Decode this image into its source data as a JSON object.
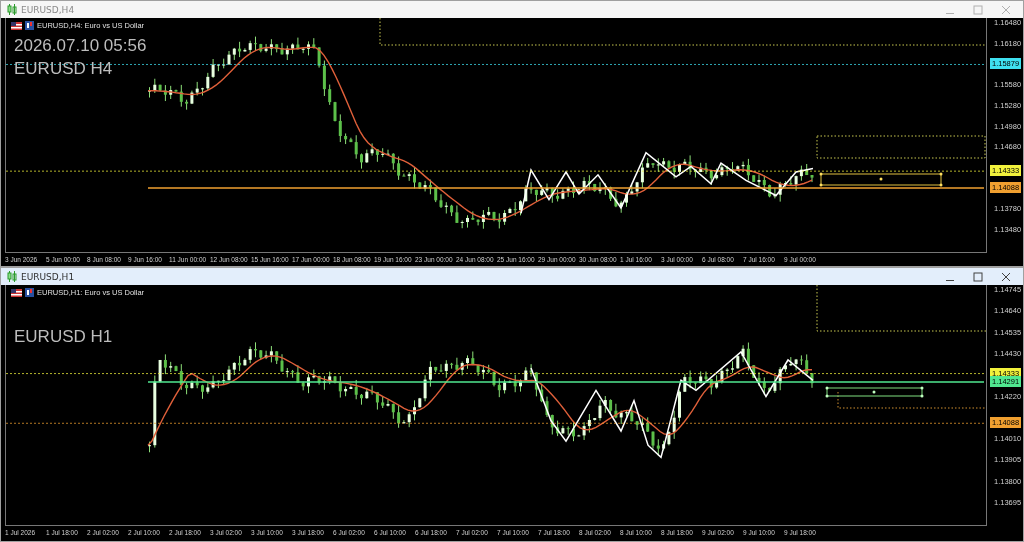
{
  "windows": [
    {
      "title": "EURUSD,H4",
      "active": false,
      "chart": {
        "header": "EURUSD,H4:  Euro vs US Dollar",
        "overlay_lines": [
          "2026.07.10 05:56",
          "EURUSD H4"
        ],
        "price_axis": [
          {
            "label": "1.16480",
            "kind": "tick"
          },
          {
            "label": "1.16180",
            "kind": "tick"
          },
          {
            "label": "1.15879",
            "kind": "marker",
            "color": "#3fe0f0"
          },
          {
            "label": "1.15580",
            "kind": "tick"
          },
          {
            "label": "1.15280",
            "kind": "tick"
          },
          {
            "label": "1.14980",
            "kind": "tick"
          },
          {
            "label": "1.14680",
            "kind": "tick"
          },
          {
            "label": "1.14333",
            "kind": "marker",
            "color": "#f2f23c"
          },
          {
            "label": "1.14088",
            "kind": "marker",
            "color": "#f0a030"
          },
          {
            "label": "1.13780",
            "kind": "tick"
          },
          {
            "label": "1.13480",
            "kind": "tick"
          }
        ],
        "time_axis": [
          "3 Jun 2026",
          "5 Jun 00:00",
          "8 Jun 08:00",
          "9 Jun 16:00",
          "11 Jun 00:00",
          "12 Jun 08:00",
          "15 Jun 16:00",
          "17 Jun 00:00",
          "18 Jun 08:00",
          "19 Jun 16:00",
          "23 Jun 00:00",
          "24 Jun 08:00",
          "25 Jun 16:00",
          "29 Jun 00:00",
          "30 Jun 08:00",
          "1 Jul 16:00",
          "3 Jul 00:00",
          "6 Jul 08:00",
          "7 Jul 16:00",
          "9 Jul 00:00"
        ]
      }
    },
    {
      "title": "EURUSD,H1",
      "active": true,
      "chart": {
        "header": "EURUSD,H1:  Euro vs US Dollar",
        "overlay_lines": [
          "EURUSD H1"
        ],
        "price_axis": [
          {
            "label": "1.14745",
            "kind": "tick"
          },
          {
            "label": "1.14640",
            "kind": "tick"
          },
          {
            "label": "1.14535",
            "kind": "tick"
          },
          {
            "label": "1.14430",
            "kind": "tick"
          },
          {
            "label": "1.14333",
            "kind": "marker",
            "color": "#f2f23c"
          },
          {
            "label": "1.14291",
            "kind": "marker",
            "color": "#50e890"
          },
          {
            "label": "1.14220",
            "kind": "tick"
          },
          {
            "label": "1.14088",
            "kind": "marker",
            "color": "#f0a030"
          },
          {
            "label": "1.14010",
            "kind": "tick"
          },
          {
            "label": "1.13905",
            "kind": "tick"
          },
          {
            "label": "1.13800",
            "kind": "tick"
          },
          {
            "label": "1.13695",
            "kind": "tick"
          }
        ],
        "time_axis": [
          "1 Jul 2026",
          "1 Jul 18:00",
          "2 Jul 02:00",
          "2 Jul 10:00",
          "2 Jul 18:00",
          "3 Jul 02:00",
          "3 Jul 10:00",
          "3 Jul 18:00",
          "6 Jul 02:00",
          "6 Jul 10:00",
          "6 Jul 18:00",
          "7 Jul 02:00",
          "7 Jul 10:00",
          "7 Jul 18:00",
          "8 Jul 02:00",
          "8 Jul 10:00",
          "8 Jul 18:00",
          "9 Jul 02:00",
          "9 Jul 10:00",
          "9 Jul 18:00"
        ]
      }
    }
  ]
}
